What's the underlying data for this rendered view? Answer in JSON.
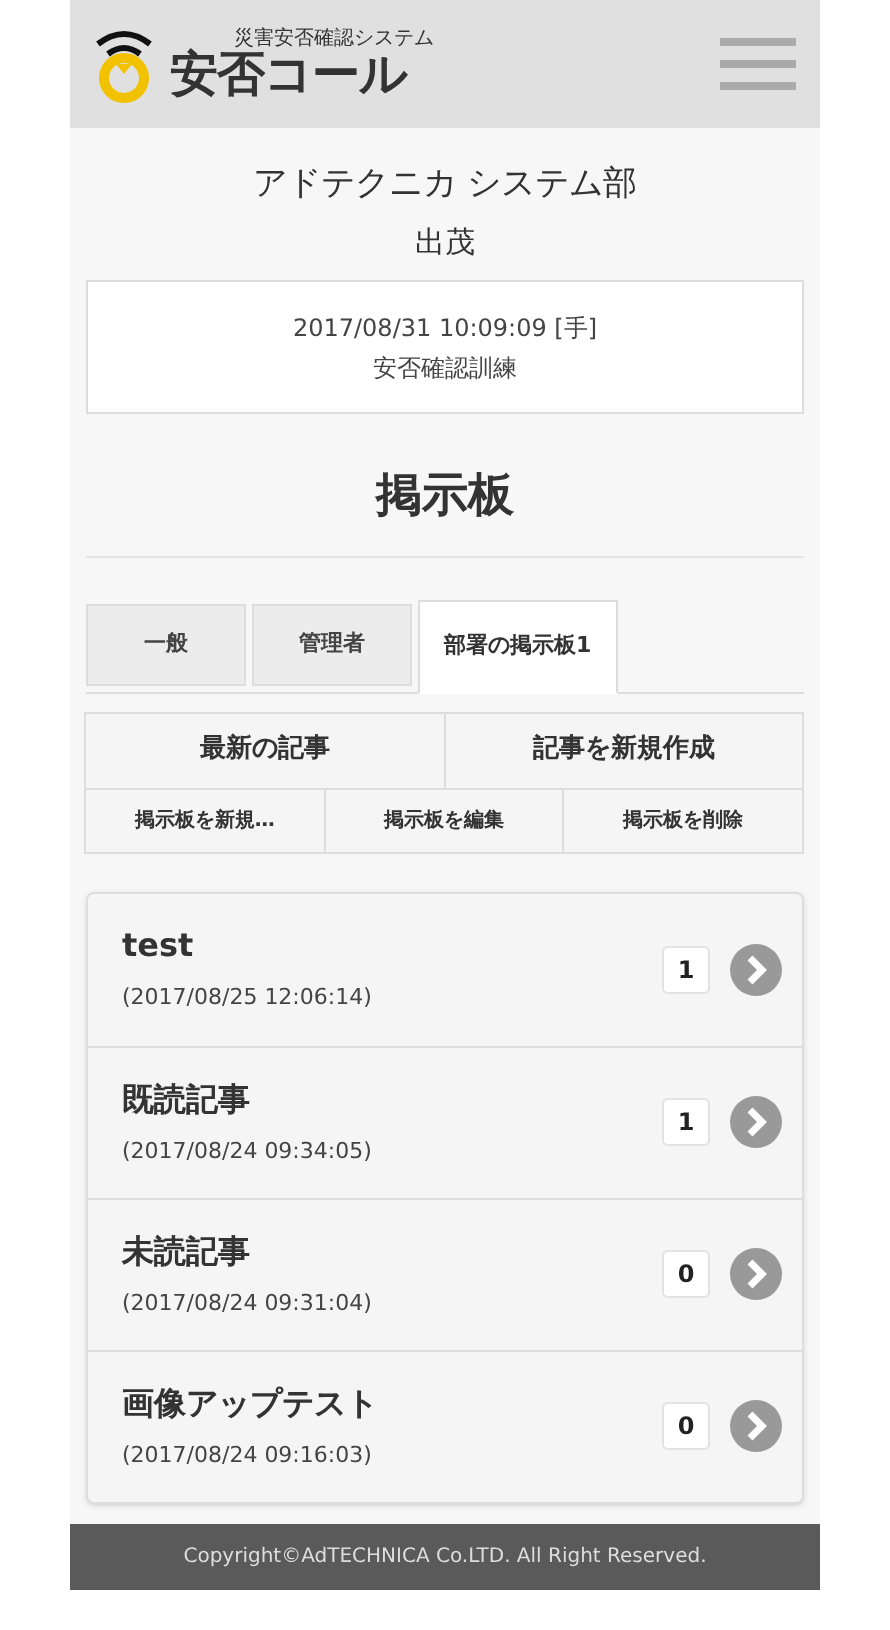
{
  "header": {
    "logo_subtitle": "災害安否確認システム",
    "logo_title": "安否コール"
  },
  "user": {
    "department": "アドテクニカ システム部",
    "name": "出茂"
  },
  "notice": {
    "datetime": "2017/08/31 10:09:09 [手]",
    "title": "安否確認訓練"
  },
  "page_title": "掲示板",
  "tabs": [
    {
      "label": "一般",
      "selected": false
    },
    {
      "label": "管理者",
      "selected": false
    },
    {
      "label": "部署の掲示板1",
      "selected": true
    }
  ],
  "primary_actions": [
    "最新の記事",
    "記事を新規作成"
  ],
  "secondary_actions": [
    "掲示板を新規…",
    "掲示板を編集",
    "掲示板を削除"
  ],
  "articles": [
    {
      "title": "test",
      "date": "(2017/08/25 12:06:14)",
      "count": "1"
    },
    {
      "title": "既読記事",
      "date": "(2017/08/24 09:34:05)",
      "count": "1"
    },
    {
      "title": "未読記事",
      "date": "(2017/08/24 09:31:04)",
      "count": "0"
    },
    {
      "title": "画像アップテスト",
      "date": "(2017/08/24 09:16:03)",
      "count": "0"
    }
  ],
  "footer": "Copyright©AdTECHNICA Co.LTD. All Right Reserved."
}
